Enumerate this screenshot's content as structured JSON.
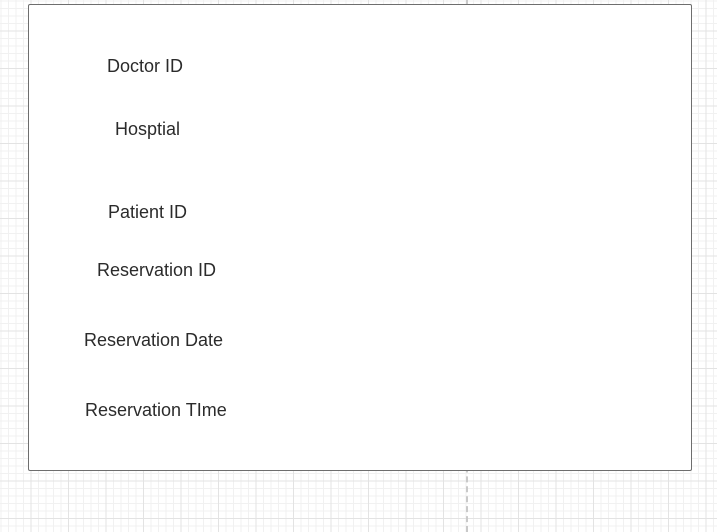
{
  "fields": {
    "doctor_id": "Doctor ID",
    "hospital": "Hosptial",
    "patient_id": "Patient ID",
    "reservation_id": "Reservation ID",
    "reservation_date": "Reservation Date",
    "reservation_time": "Reservation TIme"
  }
}
